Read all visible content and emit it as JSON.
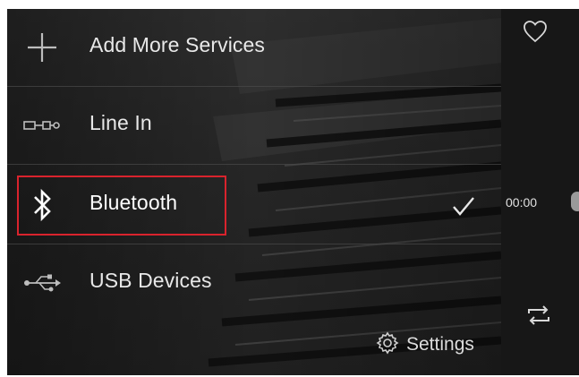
{
  "menu": {
    "items": [
      {
        "label": "Add More Services",
        "icon": "plus-icon"
      },
      {
        "label": "Line In",
        "icon": "line-in-icon"
      },
      {
        "label": "Bluetooth",
        "icon": "bluetooth-icon",
        "selected": true
      },
      {
        "label": "USB Devices",
        "icon": "usb-icon"
      }
    ],
    "settings_label": "Settings"
  },
  "player": {
    "time": "00:00",
    "icons": [
      "heart-icon",
      "repeat-icon"
    ]
  },
  "colors": {
    "highlight": "#d9232d",
    "text": "#e8e8e8",
    "background": "#262626"
  }
}
